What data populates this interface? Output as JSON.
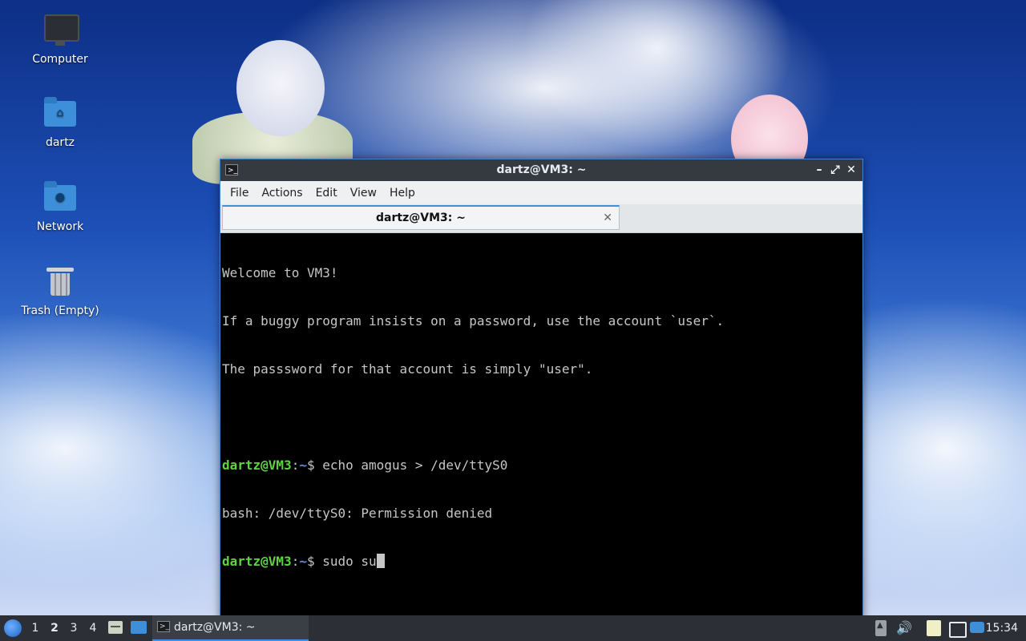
{
  "desktop": {
    "icons": [
      {
        "label": "Computer",
        "icon": "monitor-icon"
      },
      {
        "label": "dartz",
        "icon": "home-folder-icon"
      },
      {
        "label": "Network",
        "icon": "network-folder-icon"
      },
      {
        "label": "Trash (Empty)",
        "icon": "trash-icon"
      }
    ]
  },
  "window": {
    "title": "dartz@VM3: ~",
    "controls": {
      "minimize": "–",
      "maximize": "⤢",
      "close": "✕"
    },
    "menu": [
      "File",
      "Actions",
      "Edit",
      "View",
      "Help"
    ],
    "tab": {
      "label": "dartz@VM3: ~",
      "close": "✕"
    }
  },
  "terminal": {
    "lines": [
      "Welcome to VM3!",
      "If a buggy program insists on a password, use the account `user`.",
      "The passsword for that account is simply \"user\"."
    ],
    "prompt_user": "dartz@VM3",
    "prompt_sep": ":",
    "prompt_path": "~",
    "prompt_char": "$ ",
    "commands": [
      {
        "cmd": "echo amogus > /dev/ttyS0",
        "output": "bash: /dev/ttyS0: Permission denied"
      },
      {
        "cmd": "sudo su",
        "output": null
      }
    ]
  },
  "panel": {
    "workspaces": [
      "1",
      "2",
      "3",
      "4"
    ],
    "active_workspace": "2",
    "task_label": "dartz@VM3: ~",
    "clock": "15:34",
    "colors": {
      "accent": "#3d8fd9",
      "prompt_user": "#5fd33d",
      "prompt_path": "#6e8bd6"
    }
  }
}
